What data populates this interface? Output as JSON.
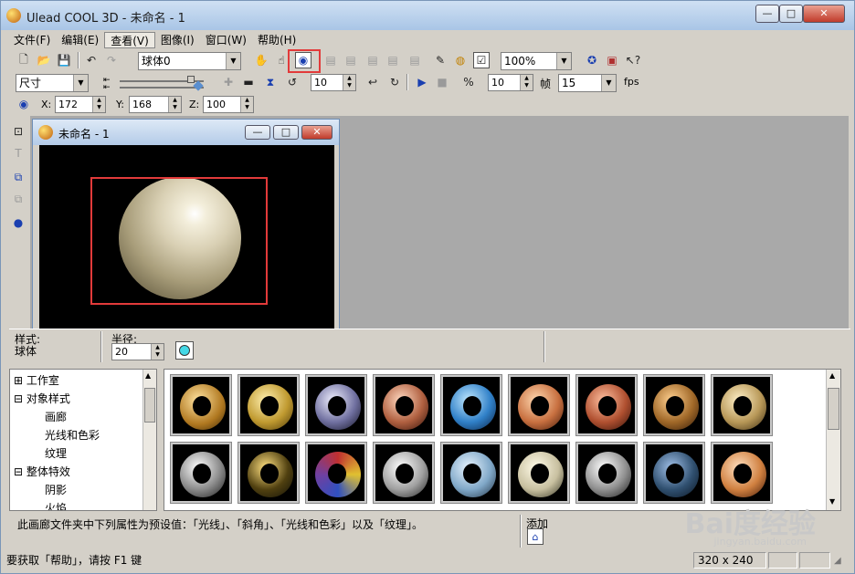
{
  "window": {
    "title": "Ulead COOL 3D - 未命名 - 1",
    "min": "—",
    "max": "□",
    "close": "✕"
  },
  "menu": [
    "文件(F)",
    "编辑(E)",
    "查看(V)",
    "图像(I)",
    "窗口(W)",
    "帮助(H)"
  ],
  "toolbar1": {
    "object_combo": "球体0",
    "zoom_combo": "100%"
  },
  "toolbar2": {
    "mode_combo": "尺寸",
    "spin1": "10",
    "spin2": "10",
    "frames_label": "帧",
    "frames_value": "15",
    "fps_label": "fps"
  },
  "toolbar3": {
    "x_label": "X:",
    "x_value": "172",
    "y_label": "Y:",
    "y_value": "168",
    "z_label": "Z:",
    "z_value": "100"
  },
  "child": {
    "title": "未命名 - 1",
    "min": "—",
    "max": "□",
    "close": "✕"
  },
  "props": {
    "style_label": "样式:",
    "style_value": "球体",
    "radius_label": "半径:",
    "radius_value": "20"
  },
  "tree": [
    {
      "sign": "⊞",
      "label": "工作室",
      "indent": 0
    },
    {
      "sign": "⊟",
      "label": "对象样式",
      "indent": 0
    },
    {
      "sign": "",
      "label": "画廊",
      "indent": 1
    },
    {
      "sign": "",
      "label": "光线和色彩",
      "indent": 1
    },
    {
      "sign": "",
      "label": "纹理",
      "indent": 1
    },
    {
      "sign": "⊟",
      "label": "整体特效",
      "indent": 0
    },
    {
      "sign": "",
      "label": "阴影",
      "indent": 1
    },
    {
      "sign": "",
      "label": "火焰",
      "indent": 1
    }
  ],
  "description": "此画廊文件夹中下列属性为预设值：「光线」、「斜角」、「光线和色彩」以及「纹理」。",
  "add_label": "添加",
  "status": {
    "help": "要获取「帮助」，请按 F1 键",
    "size": "320 x 240"
  },
  "watermark": {
    "brand": "Bai度经验",
    "url": "jingyan.baidu.com"
  },
  "colors": {
    "accent_red": "#e23a3a",
    "canvas": "#000000",
    "workspace": "#a9a9a9"
  }
}
